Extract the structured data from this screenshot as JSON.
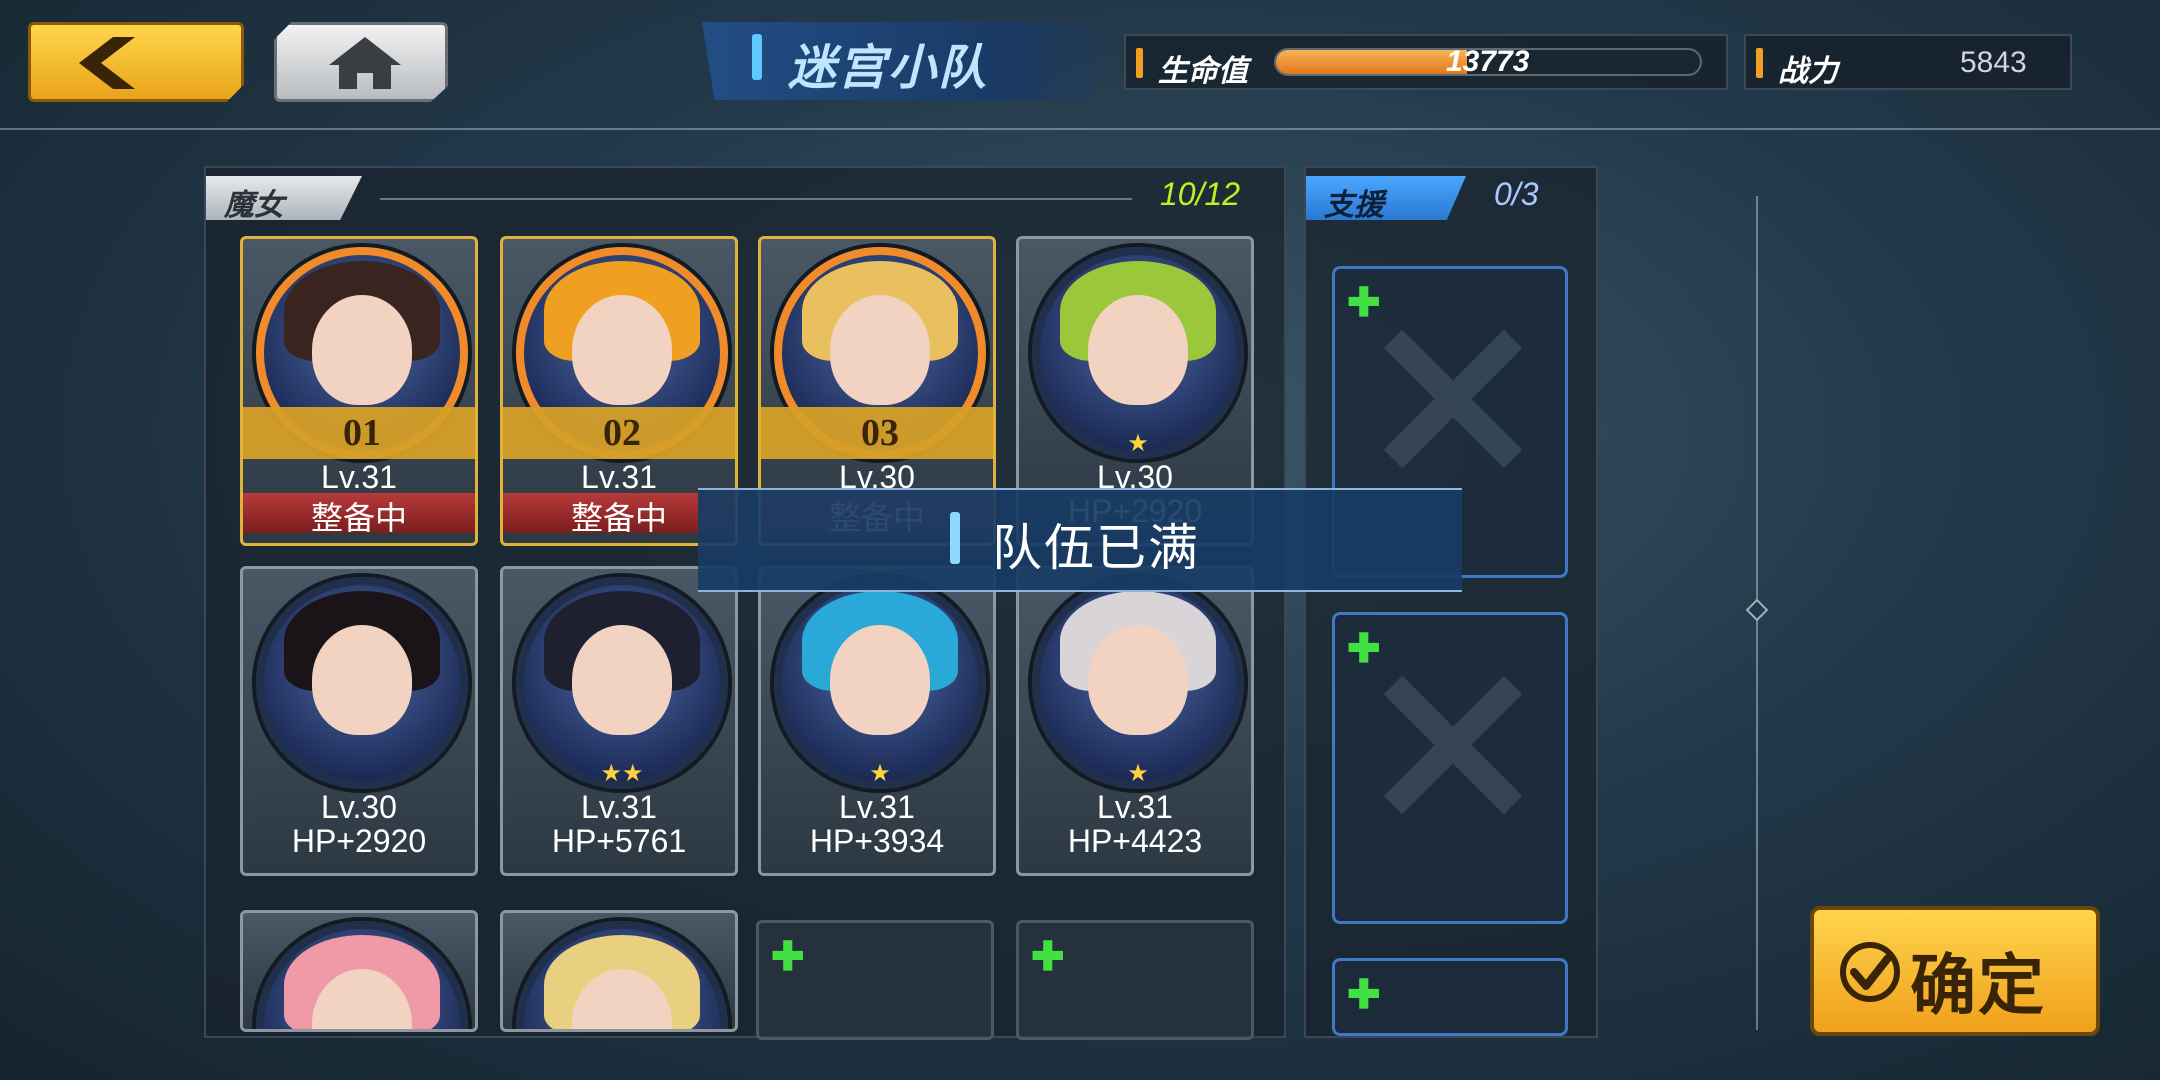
{
  "header": {
    "title": "迷宫小队",
    "hp_label": "生命值",
    "hp_value": "13773",
    "hp_fill_fraction": 0.45,
    "power_label": "战力",
    "power_value": "5843"
  },
  "witch_panel": {
    "tab_label": "魔女",
    "count": "10/12",
    "cards": [
      {
        "team_no": "01",
        "level": "Lv.31",
        "sub": "整备中",
        "stars": "",
        "ring": "orange",
        "hair": "#3a2420"
      },
      {
        "team_no": "02",
        "level": "Lv.31",
        "sub": "整备中",
        "stars": "",
        "ring": "orange",
        "hair": "#f0a020"
      },
      {
        "team_no": "03",
        "level": "Lv.30",
        "sub": "整备中",
        "stars": "",
        "ring": "orange",
        "hair": "#e8c060"
      },
      {
        "team_no": "",
        "level": "Lv.30",
        "sub": "HP+2920",
        "stars": "★",
        "ring": "blue",
        "hair": "#9ac83a"
      },
      {
        "team_no": "",
        "level": "Lv.30",
        "sub": "HP+2920",
        "stars": "",
        "ring": "blue",
        "hair": "#1a1418"
      },
      {
        "team_no": "",
        "level": "Lv.31",
        "sub": "HP+5761",
        "stars": "★★",
        "ring": "blue",
        "hair": "#1e2030"
      },
      {
        "team_no": "",
        "level": "Lv.31",
        "sub": "HP+3934",
        "stars": "★",
        "ring": "blue",
        "hair": "#2aa8d8"
      },
      {
        "team_no": "",
        "level": "Lv.31",
        "sub": "HP+4423",
        "stars": "★",
        "ring": "blue",
        "hair": "#d8d4d8"
      },
      {
        "team_no": "",
        "level": "",
        "sub": "",
        "stars": "",
        "ring": "blue",
        "hair": "#f09aa8"
      },
      {
        "team_no": "",
        "level": "",
        "sub": "",
        "stars": "",
        "ring": "blue",
        "hair": "#e8d080"
      }
    ],
    "empty_slot_icon": "plus-icon"
  },
  "support_panel": {
    "tab_label": "支援",
    "count": "0/3",
    "slot_icon": "plus-icon"
  },
  "toast": {
    "text": "队伍已满"
  },
  "confirm": {
    "label": "确定"
  },
  "colors": {
    "accent_gold": "#f0b020",
    "accent_blue": "#3a8ce0",
    "plus_green": "#42e042",
    "count_green": "#c4f020"
  }
}
